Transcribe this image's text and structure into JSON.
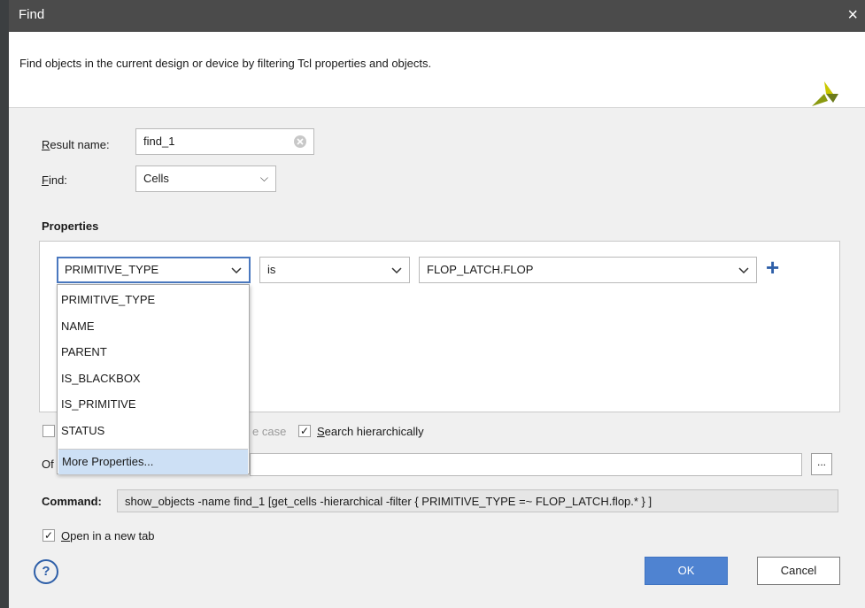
{
  "window": {
    "title": "Find",
    "close_glyph": "×"
  },
  "banner": {
    "description": "Find objects in the current design or device by filtering Tcl properties and objects."
  },
  "result_name": {
    "label_mnemonic": "R",
    "label_rest": "esult name:",
    "value": "find_1"
  },
  "find": {
    "label_mnemonic": "F",
    "label_rest": "ind:",
    "value": "Cells"
  },
  "properties": {
    "title": "Properties",
    "row": {
      "property": "PRIMITIVE_TYPE",
      "operator": "is",
      "value": "FLOP_LATCH.FLOP"
    },
    "add_icon": "+"
  },
  "dropdown": {
    "items": [
      "PRIMITIVE_TYPE",
      "NAME",
      "PARENT",
      "IS_BLACKBOX",
      "IS_PRIMITIVE",
      "STATUS"
    ],
    "more": "More Properties..."
  },
  "options": {
    "match_case_partial": "e case",
    "search_hier_mnemonic": "S",
    "search_hier_rest": "earch hierarchically",
    "search_hier_checked": true
  },
  "of_objects": {
    "label_partial": "Of",
    "browse_label": "..."
  },
  "command": {
    "label": "Command:",
    "value": "show_objects -name find_1 [get_cells -hierarchical -filter { PRIMITIVE_TYPE =~ FLOP_LATCH.flop.* } ]"
  },
  "open_new_tab": {
    "checked": true,
    "mnemonic": "O",
    "rest": "pen in a new tab"
  },
  "buttons": {
    "ok": "OK",
    "cancel": "Cancel",
    "help": "?"
  },
  "colors": {
    "accent": "#4f83d1",
    "titlebar": "#4b4b4b",
    "logo_dark": "#6b7a1b",
    "logo_light": "#c9c700"
  }
}
